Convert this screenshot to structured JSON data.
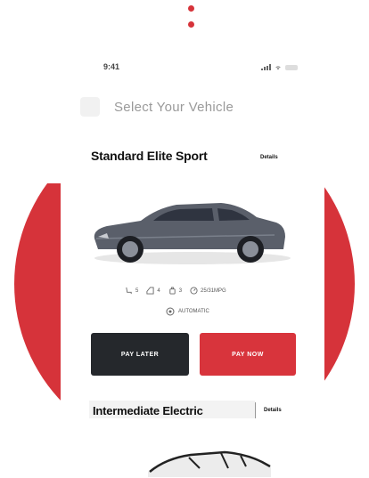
{
  "status_bar": {
    "time": "9:41"
  },
  "header": {
    "title": "Select Your Vehicle"
  },
  "vehicles": [
    {
      "name": "Standard Elite Sport",
      "details_label": "Details",
      "specs": {
        "seats": "5",
        "doors": "4",
        "bags": "3",
        "mileage": "25/31MPG"
      },
      "transmission": "AUTOMATIC",
      "car_color": "#5a5f6a"
    },
    {
      "name": "Intermediate Electric",
      "details_label": "Details"
    }
  ],
  "actions": {
    "pay_later": "PAY LATER",
    "pay_now": "PAY NOW"
  },
  "colors": {
    "accent": "#d6333a",
    "dark_button": "#25282c"
  }
}
